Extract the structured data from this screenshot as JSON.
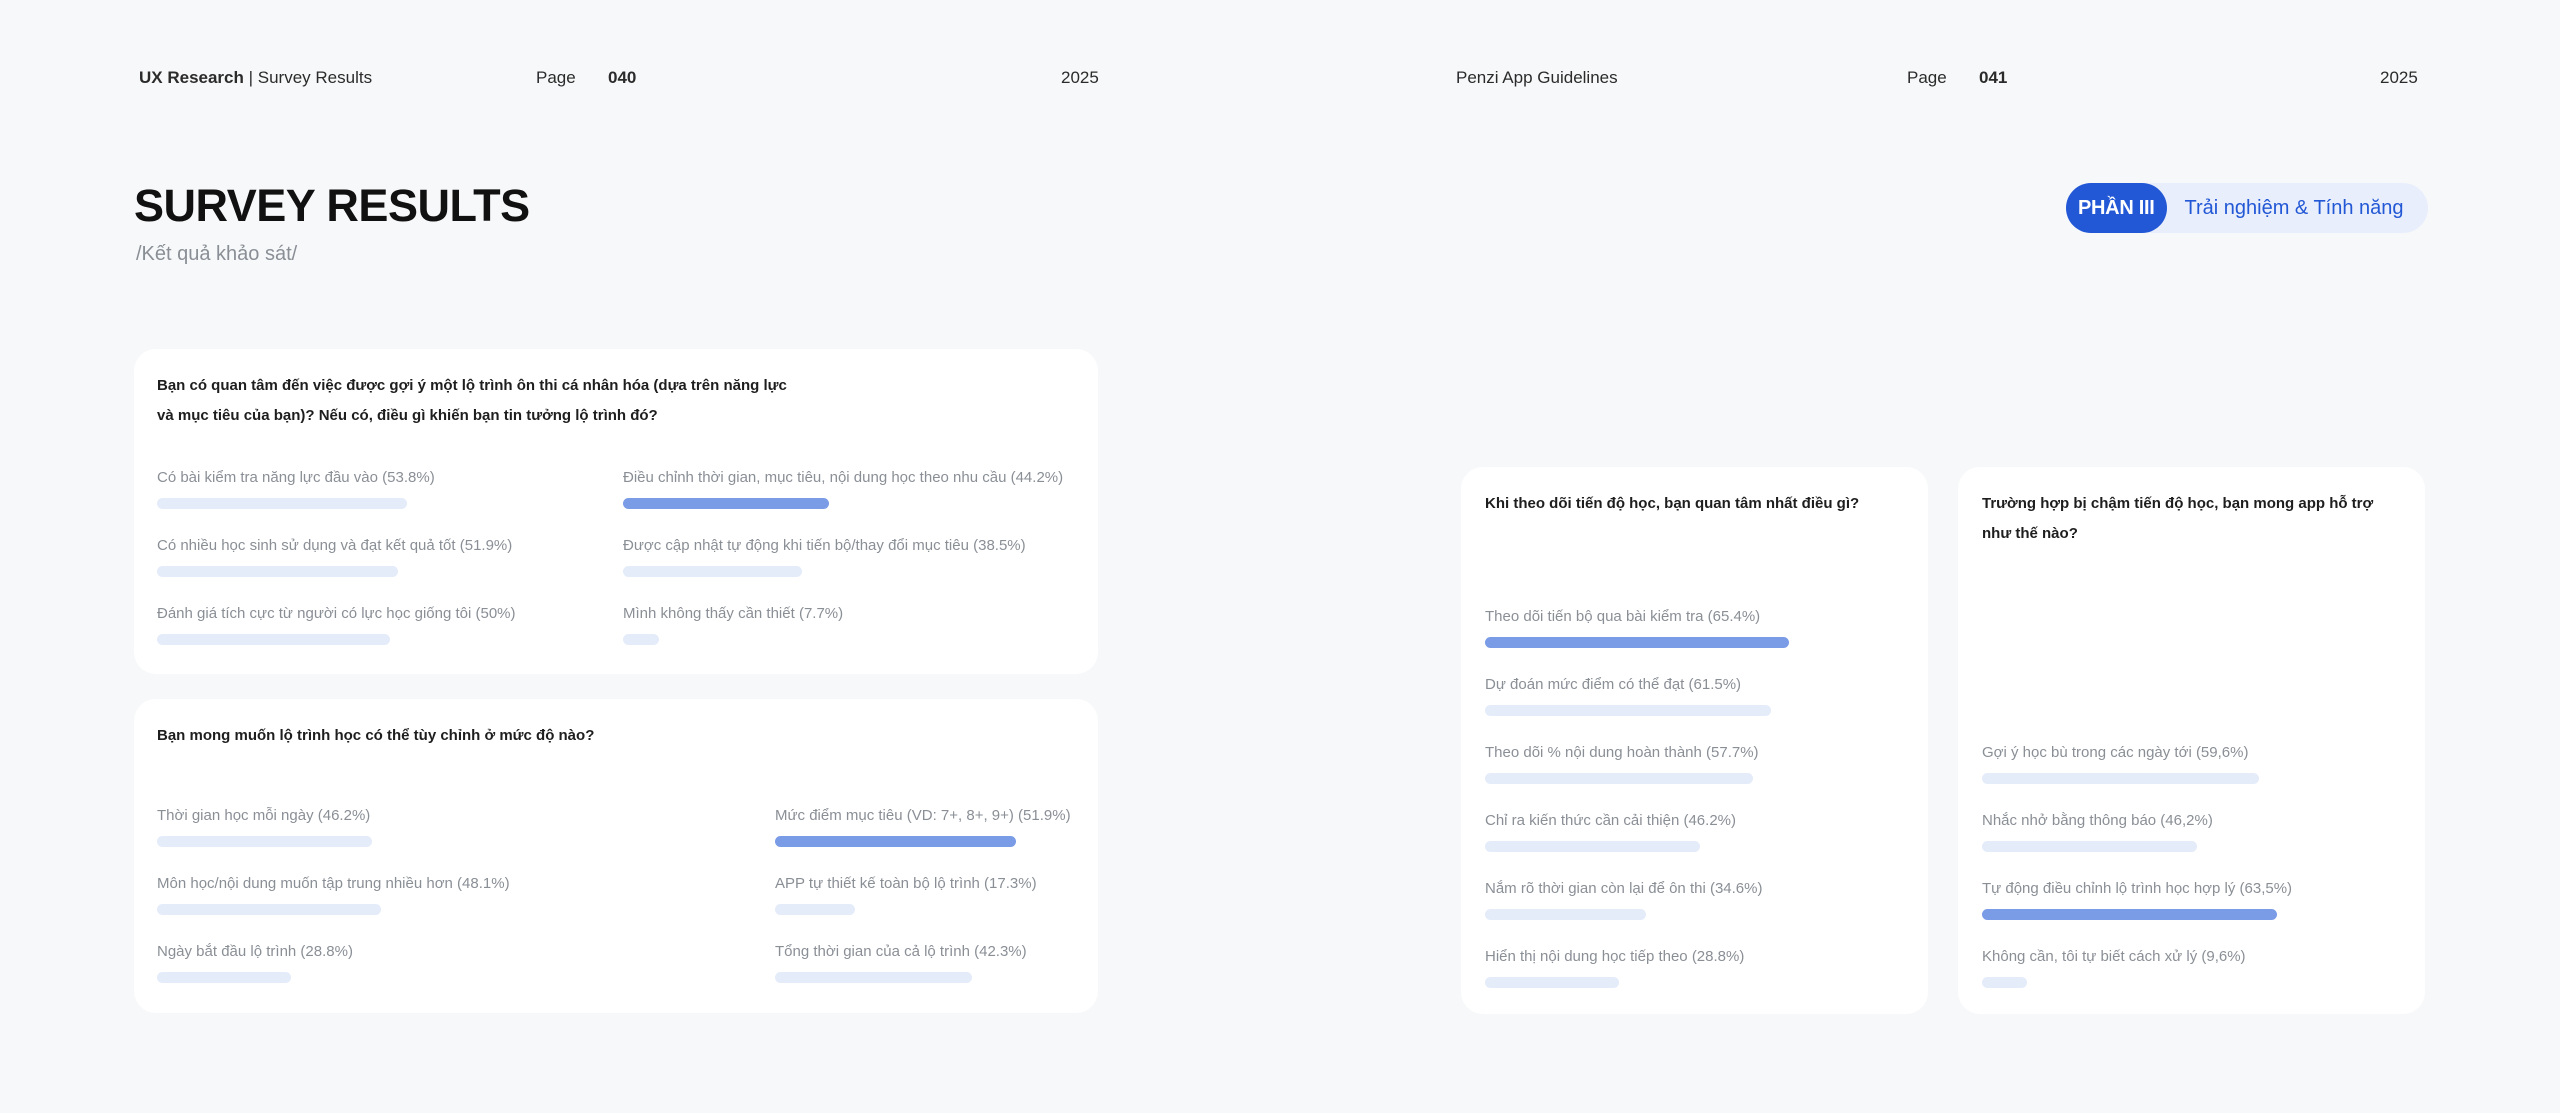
{
  "header": {
    "left_brand": "UX Research",
    "left_section": "Survey Results",
    "left_page_label": "Page",
    "left_page_num": "040",
    "left_year": "2025",
    "right_title": "Penzi App Guidelines",
    "right_page_label": "Page",
    "right_page_num": "041",
    "right_year": "2025"
  },
  "page": {
    "title": "SURVEY RESULTS",
    "subtitle": "/Kết quả khảo sát/"
  },
  "phase": {
    "number": "PHẦN III",
    "label": "Trải nghiệm & Tính năng"
  },
  "colors": {
    "accent": "#2257d6",
    "bar_highlight": "#7a9be6",
    "bar_default": "#e4ebf9",
    "card": "#ffffff",
    "background": "#f7f8f9"
  },
  "cards": {
    "c1": {
      "question_line1": "Bạn có quan tâm đến việc được gợi ý một lộ trình ôn thi cá nhân hóa (dựa trên năng lực",
      "question_line2": "và mục tiêu của bạn)? Nếu có, điều gì khiến bạn tin tưởng lộ trình đó?",
      "options": [
        {
          "label": "Có bài kiểm tra năng lực đầu vào (53.8%)",
          "percent": 53.8
        },
        {
          "label": "Điều chỉnh thời gian, mục tiêu, nội dung học theo nhu cầu (44.2%)",
          "percent": 44.2,
          "highlight": true
        },
        {
          "label": "Có nhiều học sinh sử dụng và đạt kết quả tốt (51.9%)",
          "percent": 51.9
        },
        {
          "label": "Được cập nhật tự động khi tiến bộ/thay đổi mục tiêu (38.5%)",
          "percent": 38.5
        },
        {
          "label": "Đánh giá tích cực từ người có lực học giống tôi (50%)",
          "percent": 50
        },
        {
          "label": "Mình không thấy cần thiết (7.7%)",
          "percent": 7.7
        }
      ]
    },
    "c2": {
      "question": "Bạn mong muốn lộ trình học có thể tùy chỉnh ở mức độ nào?",
      "options": [
        {
          "label": "Thời gian học mỗi ngày (46.2%)",
          "percent": 46.2
        },
        {
          "label": "Mức điểm mục tiêu (VD: 7+, 8+, 9+) (51.9%)",
          "percent": 51.9,
          "highlight": true
        },
        {
          "label": "Môn học/nội dung muốn tập trung nhiều hơn (48.1%)",
          "percent": 48.1
        },
        {
          "label": "APP tự thiết kế toàn bộ lộ trình (17.3%)",
          "percent": 17.3
        },
        {
          "label": "Ngày bắt đầu lộ trình (28.8%)",
          "percent": 28.8
        },
        {
          "label": "Tổng thời gian của cả lộ trình (42.3%)",
          "percent": 42.3
        }
      ]
    },
    "c3": {
      "question": "Khi theo dõi tiến độ học, bạn quan tâm nhất điều gì?",
      "options": [
        {
          "label": "Theo dõi tiến bộ qua bài kiểm tra (65.4%)",
          "percent": 65.4,
          "highlight": true
        },
        {
          "label": "Dự đoán mức điểm có thể đạt (61.5%)",
          "percent": 61.5
        },
        {
          "label": "Theo dõi % nội dung hoàn thành (57.7%)",
          "percent": 57.7
        },
        {
          "label": "Chỉ ra kiến thức cần cải thiện (46.2%)",
          "percent": 46.2
        },
        {
          "label": "Nắm rõ thời gian còn lại để ôn thi (34.6%)",
          "percent": 34.6
        },
        {
          "label": "Hiển thị nội dung học tiếp theo (28.8%)",
          "percent": 28.8
        }
      ]
    },
    "c4": {
      "question_line1": "Trường hợp bị chậm tiến độ học, bạn mong app hỗ trợ",
      "question_line2": "như thế nào?",
      "options": [
        {
          "label": "Gợi ý học bù trong các ngày tới (59,6%)",
          "percent": 59.6
        },
        {
          "label": "Nhắc nhở bằng thông báo (46,2%)",
          "percent": 46.2
        },
        {
          "label": "Tự động điều chỉnh lộ trình học hợp lý (63,5%)",
          "percent": 63.5,
          "highlight": true
        },
        {
          "label": "Không cần, tôi tự biết cách xử lý (9,6%)",
          "percent": 9.6
        }
      ]
    }
  }
}
